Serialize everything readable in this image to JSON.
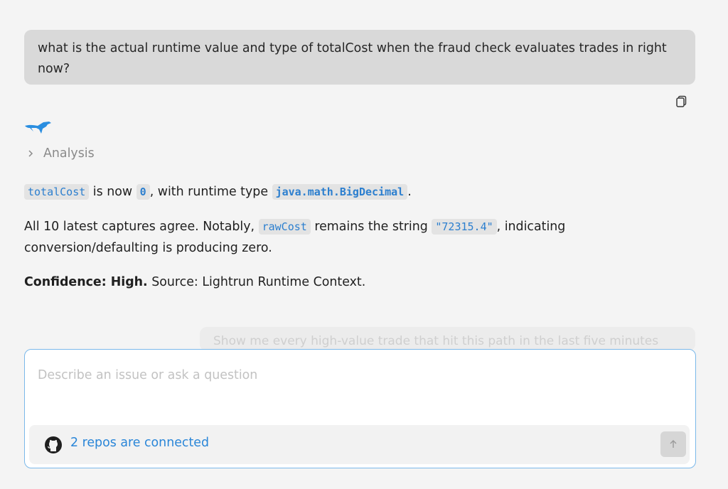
{
  "user_message": {
    "text": "what is the actual runtime value and type of totalCost when the fraud check evaluates trades in right now?"
  },
  "icons": {
    "copy": "copy-icon",
    "logo": "lightrun-logo-icon",
    "chevron": "chevron-right-icon",
    "github": "github-icon",
    "send": "arrow-up-icon"
  },
  "analysis": {
    "label": "Analysis"
  },
  "answer": {
    "p1": {
      "code_var": "totalCost",
      "t1": " is now ",
      "code_val": "0",
      "t2": ", with runtime type ",
      "code_type": "java.math.BigDecimal",
      "t3": "."
    },
    "p2": {
      "t1": "All 10 latest captures agree. Notably, ",
      "code_var": "rawCost",
      "t2": " remains the string ",
      "code_val": "\"72315.4\"",
      "t3": ", indicating conversion/defaulting is producing zero."
    },
    "p3": {
      "bold": "Confidence: High.",
      "rest": " Source: Lightrun Runtime Context."
    }
  },
  "suggestion": {
    "text": "Show me every high-value trade that hit this path in the last five minutes"
  },
  "composer": {
    "placeholder": "Describe an issue or ask a question",
    "repos_label": "2 repos are connected"
  },
  "colors": {
    "accent": "#2a86d8",
    "user_bubble": "#d9d9d9",
    "background": "#f4f4f4",
    "code_text": "#2c7fcf"
  }
}
